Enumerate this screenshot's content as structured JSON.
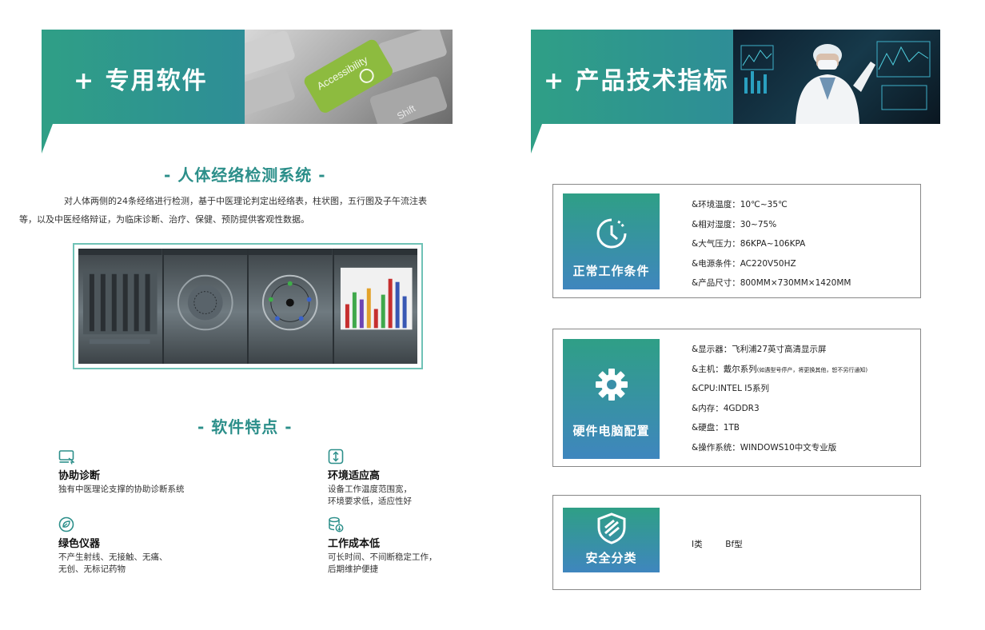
{
  "left": {
    "banner_title": "+ 专用软件",
    "banner_photo_key_text": "Accessibility",
    "banner_photo_key_text2": "Shift",
    "system_title": "- 人体经络检测系统 -",
    "intro_line1": "对人体两侧的24条经络进行检测，基于中医理论判定出经络表，柱状图，五行图及子午流注表",
    "intro_line2": "等，以及中医经络辩证，为临床诊断、治疗、保健、预防提供客观性数据。",
    "features_title": "- 软件特点 -",
    "features": [
      {
        "icon": "monitor-cursor-icon",
        "title": "协助诊断",
        "desc": [
          "独有中医理论支撑的协助诊断系统"
        ]
      },
      {
        "icon": "leaf-circle-icon",
        "title": "绿色仪器",
        "desc": [
          "不产生射线、无接触、无痛、",
          "无创、无标记药物"
        ]
      },
      {
        "icon": "vertical-arrows-icon",
        "title": "环境适应高",
        "desc": [
          "设备工作温度范围宽，",
          "环境要求低，适应性好"
        ]
      },
      {
        "icon": "database-download-icon",
        "title": "工作成本低",
        "desc": [
          "可长时间、不间断稳定工作，",
          "后期维护便捷"
        ]
      }
    ]
  },
  "right": {
    "banner_title": "+ 产品技术指标",
    "cards": [
      {
        "label": "正常工作条件",
        "icon": "clock-icon",
        "specs": [
          "&环境温度：10℃~35℃",
          "&相对湿度：30~75%",
          "&大气压力：86KPA~106KPA",
          "&电源条件：AC220V50HZ",
          "&产品尺寸：800MM×730MM×1420MM"
        ]
      },
      {
        "label": "硬件电脑配置",
        "icon": "gear-icon",
        "specs": [
          "&显示器：飞利浦27英寸高清显示屏",
          "&主机：戴尔系列",
          "&CPU:INTEL I5系列",
          "&内存：4GDDR3",
          "&硬盘：1TB",
          "&操作系统：WINDOWS10中文专业版"
        ],
        "host_note": "(如遇型号停产，将更换其他，恕不另行通知)"
      },
      {
        "label": "安全分类",
        "icon": "shield-icon",
        "class_a": "I类",
        "class_b": "Bf型"
      }
    ]
  },
  "colors": {
    "brand_green": "#2f9f86",
    "brand_blue": "#3f86be",
    "title_teal": "#2c8f8a"
  }
}
